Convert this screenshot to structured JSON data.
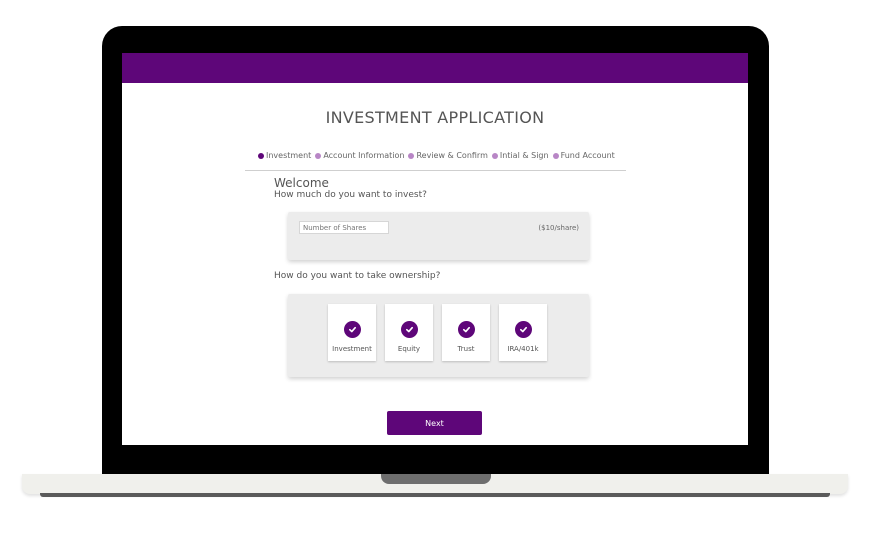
{
  "app": {
    "title": "INVESTMENT APPLICATION",
    "brand_color": "#5e0679"
  },
  "steps": [
    {
      "label": "Investment",
      "active": true
    },
    {
      "label": "Account Information",
      "active": false
    },
    {
      "label": "Review & Confirm",
      "active": false
    },
    {
      "label": "Intial & Sign",
      "active": false
    },
    {
      "label": "Fund Account",
      "active": false
    }
  ],
  "form": {
    "welcome": "Welcome",
    "invest_question": "How much do you want to invest?",
    "shares_placeholder": "Number of Shares",
    "shares_value": "",
    "price_note": "($10/share)",
    "ownership_question": "How do you want to take ownership?",
    "ownership_options": [
      {
        "label": "Investment",
        "icon": "check-icon"
      },
      {
        "label": "Equity",
        "icon": "check-icon"
      },
      {
        "label": "Trust",
        "icon": "check-icon"
      },
      {
        "label": "IRA/401k",
        "icon": "check-icon"
      }
    ],
    "next_label": "Next"
  }
}
